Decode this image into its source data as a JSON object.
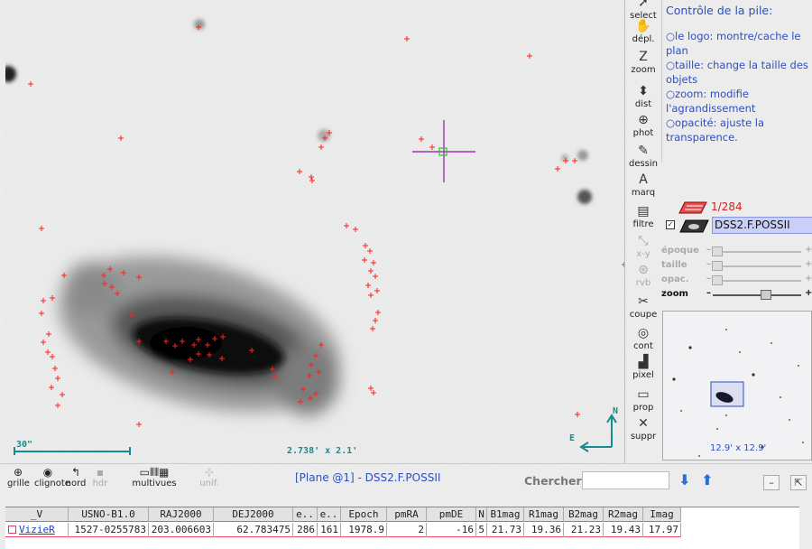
{
  "sky": {
    "scale_label": "30\"",
    "fov_label": "2.738' x 2.1'",
    "compass": {
      "north": "N",
      "east": "E"
    }
  },
  "tools": [
    {
      "label": "select",
      "icon": "select-arrow-icon",
      "glyph": "➚",
      "active": true
    },
    {
      "label": "dépl.",
      "icon": "hand-icon",
      "glyph": "✋"
    },
    {
      "label": "zoom",
      "icon": "zoom-icon",
      "glyph": "Z"
    },
    {
      "label": "dist",
      "icon": "distance-icon",
      "glyph": "⬍"
    },
    {
      "label": "phot",
      "icon": "photometry-icon",
      "glyph": "⊕"
    },
    {
      "label": "dessin",
      "icon": "pencil-icon",
      "glyph": "✎"
    },
    {
      "label": "marq",
      "icon": "marker-icon",
      "glyph": "A"
    },
    {
      "label": "filtre",
      "icon": "filter-icon",
      "glyph": "▤"
    },
    {
      "label": "x-y",
      "icon": "xy-plot-icon",
      "glyph": "⤡",
      "disabled": true
    },
    {
      "label": "rvb",
      "icon": "rgb-icon",
      "glyph": "⊛",
      "disabled": true
    },
    {
      "label": "coupe",
      "icon": "scissors-icon",
      "glyph": "✂"
    },
    {
      "label": "cont",
      "icon": "contour-icon",
      "glyph": "◎"
    },
    {
      "label": "pixel",
      "icon": "pixel-histogram-icon",
      "glyph": "▟"
    },
    {
      "label": "prop",
      "icon": "properties-icon",
      "glyph": "▭"
    },
    {
      "label": "suppr",
      "icon": "delete-icon",
      "glyph": "✕"
    }
  ],
  "help": {
    "title": "Contrôle de la pile:",
    "items": [
      "○le logo: montre/cache le plan",
      "○taille: change la taille des objets",
      "○zoom: modifie l'agrandissement",
      "○opacité: ajuste la transparence."
    ]
  },
  "stack": {
    "plane_count": "1/284",
    "plane_name": "DSS2.F.POSSII",
    "checked": "✓"
  },
  "sliders": [
    {
      "label": "époque",
      "level": 0.05,
      "active": false
    },
    {
      "label": "taille",
      "level": 0.05,
      "active": false
    },
    {
      "label": "opac.",
      "level": 0.05,
      "active": false
    },
    {
      "label": "zoom",
      "level": 0.6,
      "active": true
    }
  ],
  "thumbnail": {
    "label": "12.9' x 12.9'"
  },
  "bottom_tools": [
    {
      "label": "grille",
      "icon": "grid-icon",
      "glyph": "⊕"
    },
    {
      "label": "clignote",
      "icon": "eye-icon",
      "glyph": "◉"
    },
    {
      "label": "nord",
      "icon": "north-arrow-icon",
      "glyph": "↰"
    },
    {
      "label": "hdr",
      "icon": "hdr-icon",
      "glyph": "▪",
      "disabled": true
    },
    {
      "label": "multivues",
      "icon": "multiview-icon",
      "glyph": "▭⫴⫴▦"
    },
    {
      "label": "unif.",
      "icon": "unify-icon",
      "glyph": "⊹",
      "disabled": true
    }
  ],
  "plane_title": "[Plane @1] - DSS2.F.POSSII",
  "search": {
    "label": "Chercher",
    "value": "",
    "placeholder": ""
  },
  "table": {
    "columns": [
      "_V",
      "USNO-B1.0",
      "RAJ2000",
      "DEJ2000",
      "e..",
      "e..",
      "Epoch",
      "pmRA",
      "pmDE",
      "N",
      "B1mag",
      "R1mag",
      "B2mag",
      "R2mag",
      "Imag"
    ],
    "rows": [
      [
        "VizieR",
        "1527-0255783",
        "203.006603",
        "62.783475",
        "286",
        "161",
        "1978.9",
        "2",
        "-16",
        "5",
        "21.73",
        "19.36",
        "21.23",
        "19.43",
        "17.97"
      ]
    ]
  },
  "colors": {
    "accent": "#2c4fbf",
    "marker": "#ff2020",
    "overlay": "#1a8a8a",
    "reticle": "#a030b0"
  }
}
